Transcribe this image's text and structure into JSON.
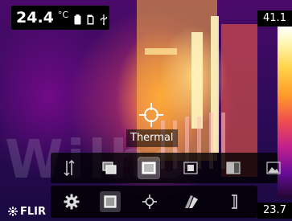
{
  "status_bar": {
    "temperature": "24.4",
    "unit": "°C",
    "icons": [
      "battery-icon",
      "sd-card-icon",
      "usb-icon"
    ]
  },
  "color_scale": {
    "max": "41.1",
    "min": "23.7"
  },
  "spot_meter": {
    "tooltip": "Thermal"
  },
  "watermark": {
    "text": "Wilho"
  },
  "image_mode_toolbar": {
    "buttons": [
      {
        "name": "scroll-arrows-icon"
      },
      {
        "name": "msx-mode-icon"
      },
      {
        "name": "thermal-mode-icon",
        "selected": true
      },
      {
        "name": "picture-in-picture-icon"
      },
      {
        "name": "thermal-blending-icon"
      },
      {
        "name": "digital-camera-icon"
      }
    ]
  },
  "main_toolbar": {
    "buttons": [
      {
        "name": "settings-gear-icon"
      },
      {
        "name": "image-mode-icon",
        "selected": true
      },
      {
        "name": "measurement-crosshair-icon"
      },
      {
        "name": "color-palette-icon"
      },
      {
        "name": "temperature-scale-icon"
      }
    ]
  },
  "logo": {
    "text": "FLIR"
  },
  "colors": {
    "toolbar_bg": "#000000",
    "selected_bg": "#ffffff",
    "text": "#ffffff"
  }
}
